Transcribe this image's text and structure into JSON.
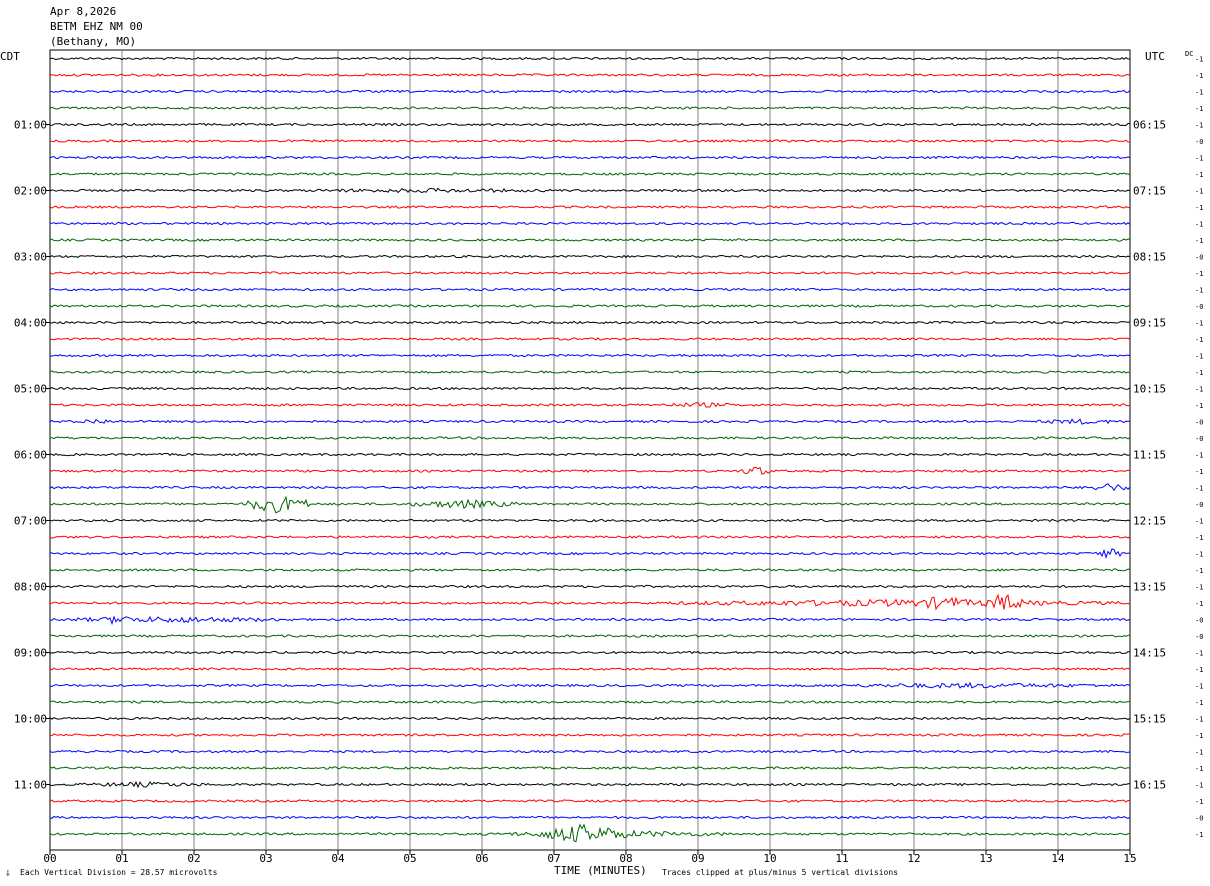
{
  "header": {
    "date": "Apr 8,2026",
    "station": "BETM EHZ NM 00",
    "location": "(Bethany, MO)"
  },
  "left_axis_title": "CDT",
  "right_axis_title": "UTC",
  "dc_label": "DC",
  "footer": {
    "scale": "Each Vertical Division =   28.57 microvolts",
    "xlabel": "TIME (MINUTES)",
    "clip": "Traces clipped at plus/minus 5 vertical divisions"
  },
  "colors": {
    "trace_cycle": [
      "#000000",
      "#ff0000",
      "#0000ff",
      "#006400"
    ],
    "grid": "#808080"
  },
  "chart_data": {
    "type": "line",
    "subtype": "helicorder",
    "x_ticks": [
      "00",
      "01",
      "02",
      "03",
      "04",
      "05",
      "06",
      "07",
      "08",
      "09",
      "10",
      "11",
      "12",
      "13",
      "14",
      "15"
    ],
    "xlim": [
      0,
      15
    ],
    "xlabel": "TIME (MINUTES)",
    "left_time_labels": [
      "01:00",
      "02:00",
      "03:00",
      "04:00",
      "05:00",
      "06:00",
      "07:00",
      "08:00",
      "09:00",
      "10:00",
      "11:00"
    ],
    "right_time_labels": [
      "06:15",
      "07:15",
      "08:15",
      "09:15",
      "10:15",
      "11:15",
      "12:15",
      "13:15",
      "14:15",
      "15:15",
      "16:15"
    ],
    "trace_count": 48,
    "dc_offsets": [
      "-1",
      "-1",
      "-1",
      "-1",
      "-1",
      "-0",
      "-1",
      "-1",
      "-1",
      "-1",
      "-1",
      "-1",
      "-0",
      "-1",
      "-1",
      "-0",
      "-1",
      "-1",
      "-1",
      "-1",
      "-1",
      "-1",
      "-0",
      "-0",
      "-1",
      "-1",
      "-1",
      "-0",
      "-1",
      "-1",
      "-1",
      "-1",
      "-1",
      "-1",
      "-0",
      "-0",
      "-1",
      "-1",
      "-1",
      "-1",
      "-1",
      "-1",
      "-1",
      "-1",
      "-1",
      "-1",
      "-0",
      "-1"
    ],
    "events": [
      {
        "trace": 8,
        "start_min": 3.0,
        "end_min": 7.5,
        "amplitude": 0.25
      },
      {
        "trace": 21,
        "start_min": 8.4,
        "end_min": 9.6,
        "amplitude": 0.3
      },
      {
        "trace": 22,
        "start_min": 0.3,
        "end_min": 1.0,
        "amplitude": 0.3
      },
      {
        "trace": 22,
        "start_min": 13.6,
        "end_min": 15.0,
        "amplitude": 0.3
      },
      {
        "trace": 25,
        "start_min": 9.6,
        "end_min": 10.0,
        "amplitude": 0.6
      },
      {
        "trace": 26,
        "start_min": 14.4,
        "end_min": 15.0,
        "amplitude": 0.5
      },
      {
        "trace": 27,
        "start_min": 2.7,
        "end_min": 3.6,
        "amplitude": 1.0
      },
      {
        "trace": 27,
        "start_min": 5.0,
        "end_min": 6.5,
        "amplitude": 0.5
      },
      {
        "trace": 30,
        "start_min": 14.5,
        "end_min": 14.9,
        "amplitude": 0.6
      },
      {
        "trace": 33,
        "start_min": 8.5,
        "end_min": 15.0,
        "amplitude": 0.4
      },
      {
        "trace": 33,
        "start_min": 12.0,
        "end_min": 12.8,
        "amplitude": 0.8
      },
      {
        "trace": 33,
        "start_min": 13.0,
        "end_min": 13.5,
        "amplitude": 1.1
      },
      {
        "trace": 34,
        "start_min": 0.0,
        "end_min": 3.5,
        "amplitude": 0.35
      },
      {
        "trace": 34,
        "start_min": 0.8,
        "end_min": 1.1,
        "amplitude": 0.7
      },
      {
        "trace": 38,
        "start_min": 10.5,
        "end_min": 15.0,
        "amplitude": 0.3
      },
      {
        "trace": 44,
        "start_min": 0.3,
        "end_min": 2.3,
        "amplitude": 0.3
      },
      {
        "trace": 47,
        "start_min": 6.2,
        "end_min": 9.5,
        "amplitude": 0.4
      },
      {
        "trace": 47,
        "start_min": 6.8,
        "end_min": 8.0,
        "amplitude": 1.1
      }
    ]
  }
}
